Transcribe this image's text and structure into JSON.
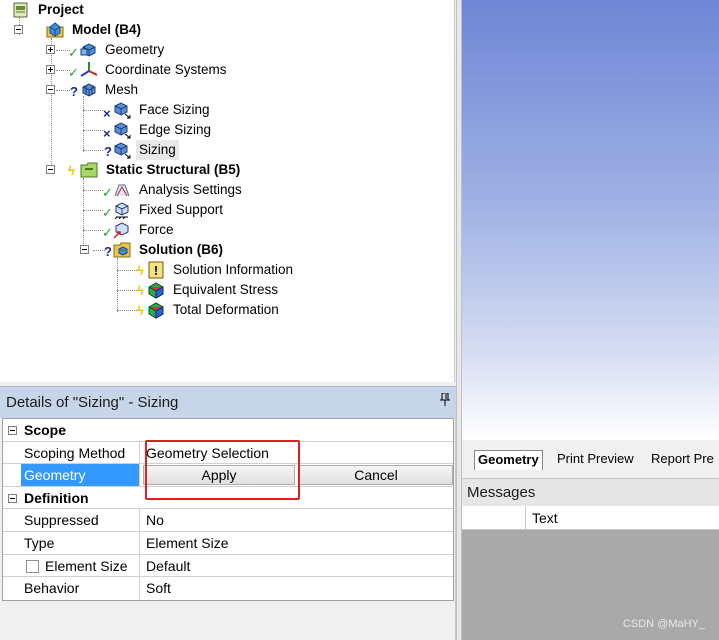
{
  "tree": {
    "nodes": [
      {
        "label": "Project",
        "bold": true,
        "status": "",
        "icon": "project-icon"
      },
      {
        "label": "Model (B4)",
        "bold": true,
        "status": "",
        "icon": "model-icon"
      },
      {
        "label": "Geometry",
        "bold": false,
        "status": "check",
        "icon": "geometry-icon"
      },
      {
        "label": "Coordinate Systems",
        "bold": false,
        "status": "check",
        "icon": "coordinate-systems-icon"
      },
      {
        "label": "Mesh",
        "bold": false,
        "status": "question",
        "icon": "mesh-icon"
      },
      {
        "label": "Face Sizing",
        "bold": false,
        "status": "x",
        "icon": "face-sizing-icon"
      },
      {
        "label": "Edge Sizing",
        "bold": false,
        "status": "x",
        "icon": "edge-sizing-icon"
      },
      {
        "label": "Sizing",
        "bold": false,
        "status": "question",
        "icon": "sizing-icon"
      },
      {
        "label": "Static Structural (B5)",
        "bold": true,
        "status": "bolt",
        "icon": "static-structural-icon"
      },
      {
        "label": "Analysis Settings",
        "bold": false,
        "status": "check",
        "icon": "analysis-settings-icon"
      },
      {
        "label": "Fixed Support",
        "bold": false,
        "status": "check",
        "icon": "fixed-support-icon"
      },
      {
        "label": "Force",
        "bold": false,
        "status": "check",
        "icon": "force-icon"
      },
      {
        "label": "Solution (B6)",
        "bold": true,
        "status": "question",
        "icon": "solution-icon"
      },
      {
        "label": "Solution Information",
        "bold": false,
        "status": "bolt",
        "icon": "solution-information-icon"
      },
      {
        "label": "Equivalent Stress",
        "bold": false,
        "status": "bolt",
        "icon": "equivalent-stress-icon"
      },
      {
        "label": "Total Deformation",
        "bold": false,
        "status": "bolt",
        "icon": "total-deformation-icon"
      }
    ]
  },
  "details": {
    "title": "Details of \"Sizing\" - Sizing",
    "pin": "",
    "groups": {
      "scope": "Scope",
      "definition": "Definition"
    },
    "rows": {
      "scoping_method": {
        "label": "Scoping Method",
        "value": "Geometry Selection"
      },
      "geometry": {
        "label": "Geometry",
        "apply": "Apply",
        "cancel": "Cancel"
      },
      "suppressed": {
        "label": "Suppressed",
        "value": "No"
      },
      "type": {
        "label": "Type",
        "value": "Element Size"
      },
      "element_size": {
        "label": "Element Size",
        "value": "Default"
      },
      "behavior": {
        "label": "Behavior",
        "value": "Soft"
      }
    }
  },
  "tabs": [
    "Geometry",
    "Print Preview",
    "Report Pre"
  ],
  "messages": {
    "title": "Messages",
    "column": "Text"
  },
  "watermark": "CSDN @MaHY_",
  "colors": {
    "selection": "#3399ff",
    "highlight_box": "#e02020",
    "panel_header": "#c7d5e8"
  }
}
